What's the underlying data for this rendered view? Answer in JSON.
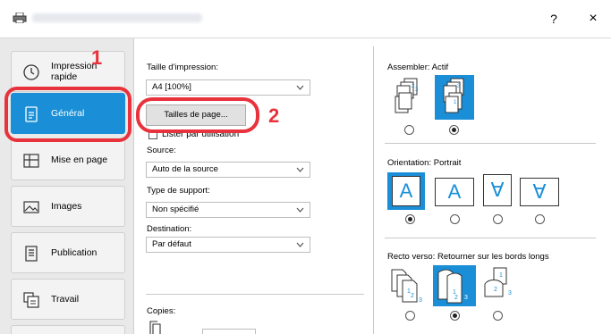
{
  "window": {
    "help_label": "?",
    "close_label": "×"
  },
  "nav": {
    "items": [
      {
        "label": "Impression rapide"
      },
      {
        "label": "Général"
      },
      {
        "label": "Mise en page"
      },
      {
        "label": "Images"
      },
      {
        "label": "Publication"
      },
      {
        "label": "Travail"
      }
    ]
  },
  "annotations": {
    "step1": "1",
    "step2": "2"
  },
  "main": {
    "print_size_label": "Taille d'impression:",
    "print_size_value": "A4  [100%]",
    "page_sizes_button": "Tailles de page...",
    "list_by_usage_label": "Lister par utilisation",
    "source_label": "Source:",
    "source_value": "Auto de la source",
    "media_type_label": "Type de support:",
    "media_type_value": "Non spécifié",
    "destination_label": "Destination:",
    "destination_value": "Par défaut",
    "copies_label": "Copies:",
    "collate_label": "Assembler:",
    "collate_value": "Actif",
    "orientation_label": "Orientation:",
    "orientation_value": "Portrait",
    "duplex_label": "Recto verso:",
    "duplex_value": "Retourner sur les bords longs",
    "orientation_glyphs": [
      "A",
      "A",
      "∀",
      "∀"
    ]
  },
  "colors": {
    "accent": "#1a8fd8",
    "annotation": "#e8323c"
  }
}
